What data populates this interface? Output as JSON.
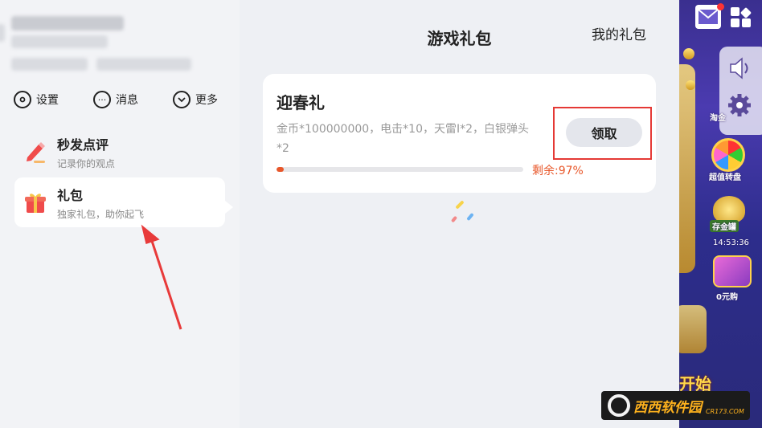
{
  "sidebar": {
    "quick_actions": [
      {
        "label": "设置",
        "icon": "settings-icon"
      },
      {
        "label": "消息",
        "icon": "chat-icon"
      },
      {
        "label": "更多",
        "icon": "chevron-down-icon"
      }
    ],
    "menu": [
      {
        "title": "秒发点评",
        "subtitle": "记录你的观点",
        "icon": "pencil-icon"
      },
      {
        "title": "礼包",
        "subtitle": "独家礼包，助你起飞",
        "icon": "gift-icon",
        "active": true
      }
    ]
  },
  "main": {
    "title": "游戏礼包",
    "my_gifts": "我的礼包",
    "gift": {
      "name": "迎春礼",
      "description": "金币*100000000，电击*10，天雷I*2，白银弹头*2",
      "claim_label": "领取",
      "remain_label": "剩余:",
      "remain_value": "97%",
      "used_fraction": 0.03
    }
  },
  "game_strip": {
    "items": [
      {
        "label": "超值转盘"
      },
      {
        "label": "存金罐"
      },
      {
        "label": "14:53:36"
      },
      {
        "label": "0元购"
      },
      {
        "label": "淘金"
      }
    ],
    "banner_fragment": "开始"
  },
  "watermark": {
    "text": "西西软件园",
    "sub": "CR173.COM"
  },
  "colors": {
    "accent": "#e8572a",
    "highlight_box": "#e53935",
    "active_bg": "#ffffff"
  }
}
